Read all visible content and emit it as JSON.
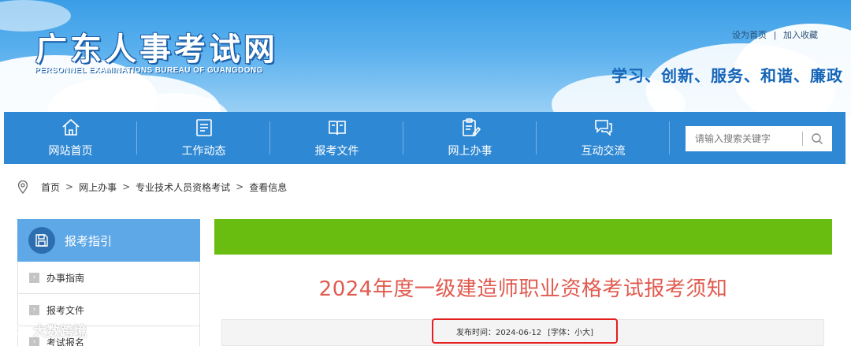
{
  "header": {
    "title": "广东人事考试网",
    "subtitle": "PERSONNEL EXAMINATIONS BUREAU OF GUANGDONG",
    "top_links": [
      "设为首页",
      "加入收藏"
    ],
    "top_links_sep": "|",
    "slogan": "学习、创新、服务、和谐、廉政"
  },
  "nav": {
    "items": [
      {
        "label": "网站首页",
        "icon": "home-icon"
      },
      {
        "label": "工作动态",
        "icon": "news-icon"
      },
      {
        "label": "报考文件",
        "icon": "book-icon"
      },
      {
        "label": "网上办事",
        "icon": "clipboard-edit-icon"
      },
      {
        "label": "互动交流",
        "icon": "chat-icon"
      }
    ],
    "search_placeholder": "请输入搜索关键字"
  },
  "breadcrumb": {
    "items": [
      "首页",
      "网上办事",
      "专业技术人员资格考试",
      "查看信息"
    ],
    "separator": ">"
  },
  "sidebar": {
    "title": "报考指引",
    "items": [
      "办事指南",
      "报考文件",
      "考试报名"
    ]
  },
  "article": {
    "title": "2024年度一级建造师职业资格考试报考须知",
    "publish_label": "发布时间：2024-06-12",
    "font_label": "[字体：",
    "font_small": "小",
    "font_large": "大",
    "font_close": "]"
  },
  "watermark": {
    "text": "大数跨境"
  },
  "colors": {
    "nav_blue": "#2f88d3",
    "sidebar_head": "#5fa8e8",
    "green_bar": "#68bd10",
    "title_red": "#e05a4f",
    "highlight_red": "#e51e1e"
  }
}
